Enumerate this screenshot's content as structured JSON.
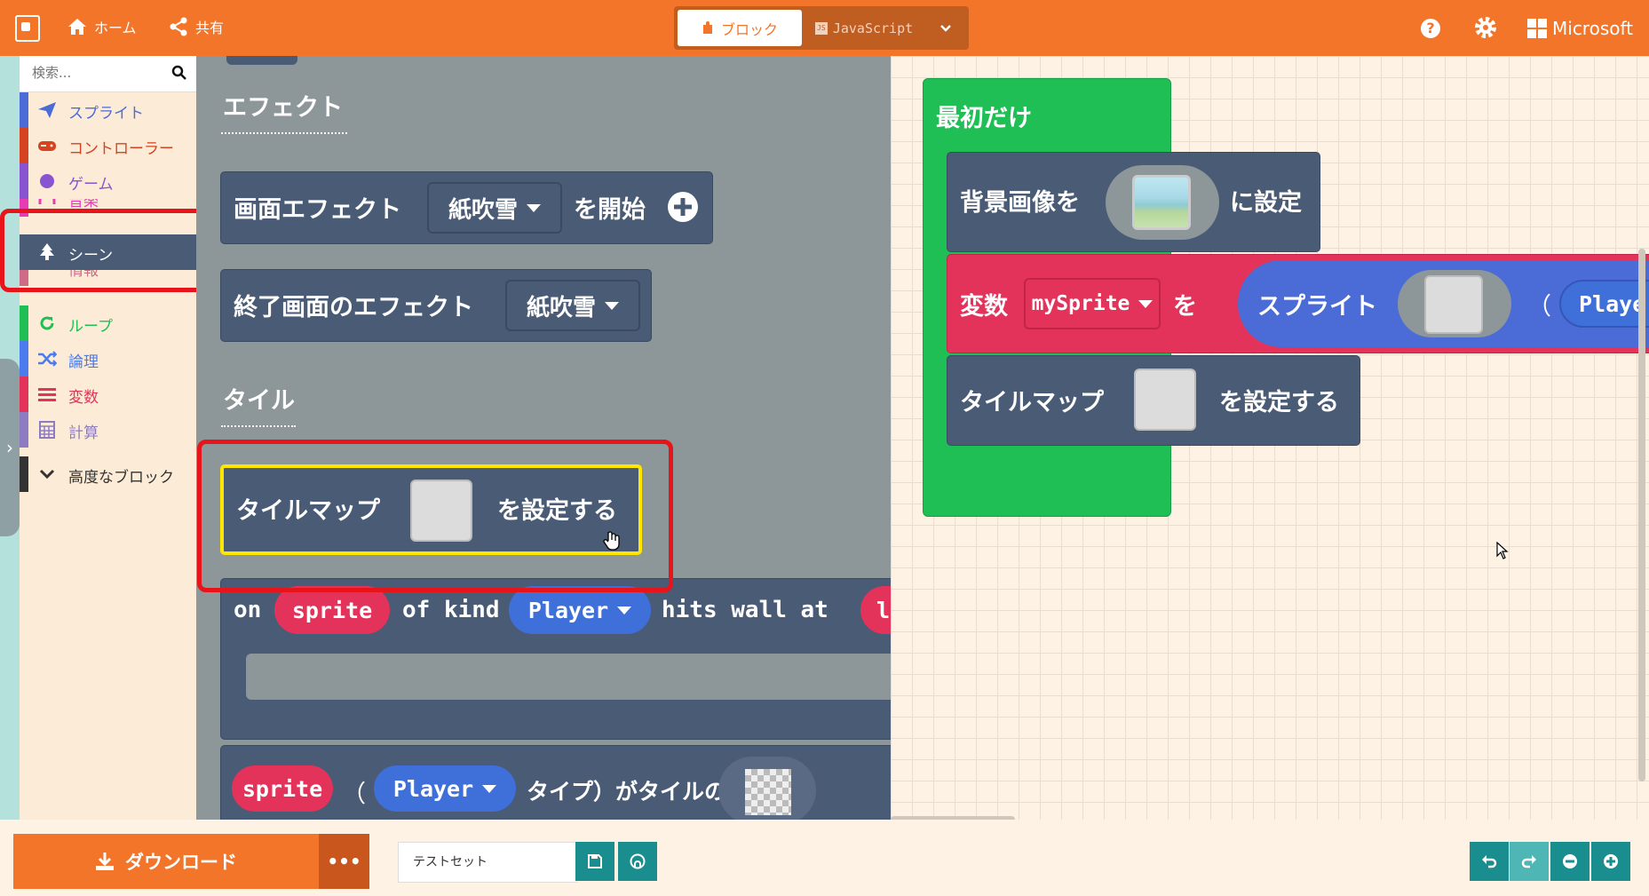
{
  "topbar": {
    "home_label": "ホーム",
    "share_label": "共有",
    "blocks_label": "ブロック",
    "js_label": "JavaScript",
    "brand": "Microsoft"
  },
  "toolbox": {
    "search_placeholder": "検索...",
    "categories": [
      {
        "label": "スプライト",
        "color": "#4b6cd6",
        "icon": "paper-plane-icon"
      },
      {
        "label": "コントローラー",
        "color": "#d54322",
        "icon": "gamepad-icon"
      },
      {
        "label": "ゲーム",
        "color": "#8854d0",
        "icon": "circle-icon"
      },
      {
        "label": "音楽",
        "color": "#e63cb4",
        "icon": "headphones-icon"
      },
      {
        "label": "シーン",
        "color": "#4a5b75",
        "icon": "tree-icon"
      },
      {
        "label": "情報",
        "color": "#cf6a87",
        "icon": "info-icon"
      },
      {
        "label": "ループ",
        "color": "#20bf55",
        "icon": "refresh-icon"
      },
      {
        "label": "論理",
        "color": "#4b7bec",
        "icon": "shuffle-icon"
      },
      {
        "label": "変数",
        "color": "#e3335a",
        "icon": "list-icon"
      },
      {
        "label": "計算",
        "color": "#8e7cc3",
        "icon": "calculator-icon"
      }
    ],
    "advanced_label": "高度なブロック"
  },
  "flyout": {
    "effects_title": "エフェクト",
    "effect_block_label": "画面エフェクト",
    "effect_value": "紙吹雪",
    "effect_start": "を開始",
    "end_effect_label": "終了画面のエフェクト",
    "end_effect_value": "紙吹雪",
    "tiles_title": "タイル",
    "tilemap_label": "タイルマップ",
    "tilemap_set": "を設定する",
    "hitwall_on": "on",
    "hitwall_sprite": "sprite",
    "hitwall_of_kind": "of kind",
    "hitwall_kind": "Player",
    "hitwall_hits": "hits wall at",
    "hitwall_loc": "loc",
    "tile_sprite": "sprite",
    "tile_paren": "（",
    "tile_kind": "Player",
    "tile_type_text": "タイプ）がタイルの"
  },
  "workspace": {
    "on_start": "最初だけ",
    "bg_label": "背景画像を",
    "bg_set": "に設定",
    "var_label": "変数",
    "var_name": "mySprite",
    "var_wo": "を",
    "sprite_label": "スプライト",
    "sprite_paren": "（",
    "sprite_kind": "Playe",
    "tilemap_label": "タイルマップ",
    "tilemap_set": "を設定する"
  },
  "bottombar": {
    "download_label": "ダウンロード",
    "more_label": "•••",
    "project_name": "テストセット"
  },
  "colors": {
    "accent": "#f2752a",
    "scene_block": "#4a5b75",
    "loop_green": "#20bf55",
    "variable_red": "#e3335a",
    "sprite_blue": "#4b6cd6",
    "highlight_red": "#e8141a",
    "highlight_yellow": "#ffe600"
  }
}
